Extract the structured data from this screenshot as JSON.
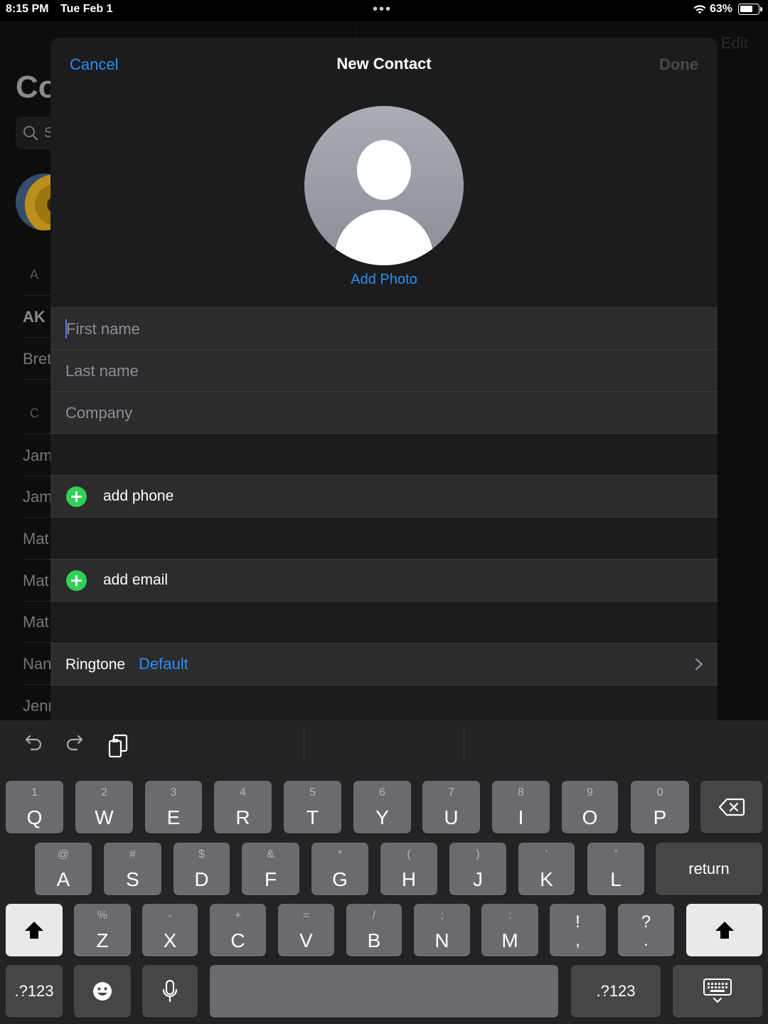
{
  "status_bar": {
    "time": "8:15 PM",
    "date": "Tue Feb 1",
    "battery": "63%"
  },
  "background": {
    "title_fragment": "Co",
    "search_fragment": "S",
    "edit_label": "Edit",
    "rows": [
      {
        "type": "section",
        "text": "A"
      },
      {
        "type": "row",
        "text": "AK"
      },
      {
        "type": "row",
        "text": "Bret"
      },
      {
        "type": "section",
        "text": "C"
      },
      {
        "type": "row",
        "text": "Jam"
      },
      {
        "type": "row",
        "text": "Jam"
      },
      {
        "type": "row",
        "text": "Mat"
      },
      {
        "type": "row",
        "text": "Mat"
      },
      {
        "type": "row",
        "text": "Mat"
      },
      {
        "type": "row",
        "text": "Nan"
      },
      {
        "type": "row",
        "text": "Jenn"
      }
    ]
  },
  "sheet": {
    "cancel_label": "Cancel",
    "title": "New Contact",
    "done_label": "Done",
    "add_photo_label": "Add Photo",
    "fields": {
      "first_name": {
        "value": "",
        "placeholder": "First name"
      },
      "last_name": {
        "value": "",
        "placeholder": "Last name"
      },
      "company": {
        "value": "",
        "placeholder": "Company"
      }
    },
    "add_phone_label": "add phone",
    "add_email_label": "add email",
    "ringtone_label": "Ringtone",
    "ringtone_value": "Default"
  },
  "keyboard": {
    "row1": [
      {
        "sub": "1",
        "main": "Q"
      },
      {
        "sub": "2",
        "main": "W"
      },
      {
        "sub": "3",
        "main": "E"
      },
      {
        "sub": "4",
        "main": "R"
      },
      {
        "sub": "5",
        "main": "T"
      },
      {
        "sub": "6",
        "main": "Y"
      },
      {
        "sub": "7",
        "main": "U"
      },
      {
        "sub": "8",
        "main": "I"
      },
      {
        "sub": "9",
        "main": "O"
      },
      {
        "sub": "0",
        "main": "P"
      }
    ],
    "row2": [
      {
        "sub": "@",
        "main": "A"
      },
      {
        "sub": "#",
        "main": "S"
      },
      {
        "sub": "$",
        "main": "D"
      },
      {
        "sub": "&",
        "main": "F"
      },
      {
        "sub": "*",
        "main": "G"
      },
      {
        "sub": "(",
        "main": "H"
      },
      {
        "sub": ")",
        "main": "J"
      },
      {
        "sub": "’",
        "main": "K"
      },
      {
        "sub": "”",
        "main": "L"
      }
    ],
    "row3": [
      {
        "sub": "%",
        "main": "Z"
      },
      {
        "sub": "-",
        "main": "X"
      },
      {
        "sub": "+",
        "main": "C"
      },
      {
        "sub": "=",
        "main": "V"
      },
      {
        "sub": "/",
        "main": "B"
      },
      {
        "sub": ";",
        "main": "N"
      },
      {
        "sub": ":",
        "main": "M"
      }
    ],
    "punct": [
      {
        "top": "!",
        "bottom": ","
      },
      {
        "top": "?",
        "bottom": "."
      }
    ],
    "return_label": "return",
    "numbers_label": ".?123",
    "icons": [
      "undo-icon",
      "redo-icon",
      "paste-icon",
      "delete-icon",
      "shift-icon",
      "emoji-icon",
      "microphone-icon",
      "dismiss-keyboard-icon"
    ]
  }
}
